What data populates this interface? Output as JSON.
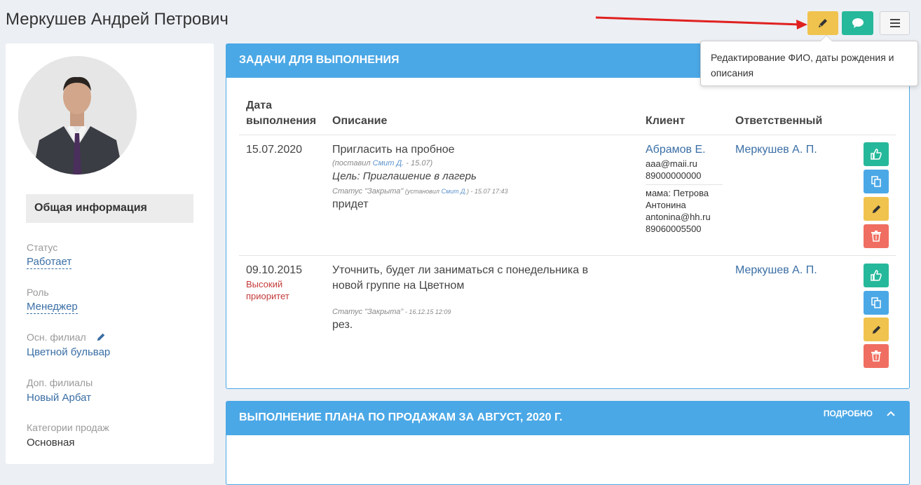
{
  "header": {
    "title": "Меркушев Андрей Петрович",
    "tooltip": "Редактирование ФИО, даты рождения и описания"
  },
  "sidebar": {
    "section_title": "Общая информация",
    "fields": [
      {
        "label": "Статус",
        "value": "Работает"
      },
      {
        "label": "Роль",
        "value": "Менеджер"
      },
      {
        "label": "Осн. филиал",
        "value": "Цветной бульвар"
      },
      {
        "label": "Доп. филиалы",
        "value": "Новый Арбат"
      },
      {
        "label": "Категории продаж",
        "value": "Основная"
      }
    ]
  },
  "tasks": {
    "title": "ЗАДАЧИ ДЛЯ ВЫПОЛНЕНИЯ",
    "columns": {
      "date": "Дата выполнения",
      "description": "Описание",
      "client": "Клиент",
      "responsible": "Ответственный"
    },
    "rows": [
      {
        "date": "15.07.2020",
        "priority": "",
        "description": "Пригласить на пробное",
        "set_prefix": "(поставил ",
        "set_by": "Смит Д.",
        "set_suffix": " - 15.07)",
        "goal": "Цель: Приглашение в лагерь",
        "status": "Статус \"Закрыта\"",
        "status_prefix": " (установил ",
        "status_by": "Смит Д.",
        "status_suffix": ") - 15.07 17:43",
        "result": "придет",
        "client_name": "Абрамов Е.",
        "client_email": "aaa@maii.ru",
        "client_phone": "89000000000",
        "client_parent_1": "мама: Петрова",
        "client_parent_2": "Антонина",
        "client_parent_email": "antonina@hh.ru",
        "client_parent_phone": "89060005500",
        "responsible": "Меркушев А. П."
      },
      {
        "date": "09.10.2015",
        "priority_1": "Высокий",
        "priority_2": "приоритет",
        "description_1": "Уточнить, будет ли заниматься с понедельника в",
        "description_2": "новой группе на Цветном",
        "status": "Статус \"Закрыта\"",
        "status_time": " - 16.12.15 12:09",
        "result": "рез.",
        "responsible": "Меркушев А. П."
      }
    ]
  },
  "sales": {
    "title": "ВЫПОЛНЕНИЕ ПЛАНА ПО ПРОДАЖАМ ЗА АВГУСТ, 2020 Г.",
    "details": "ПОДРОБНО"
  },
  "icons": {
    "edit": "pencil-icon",
    "chat": "chat-bubble-icon",
    "menu": "hamburger-icon",
    "like": "thumbs-up-icon",
    "copy": "copy-icon",
    "delete": "trash-icon"
  },
  "colors": {
    "panel_header": "#4ba8e6",
    "edit_button": "#f0c34e",
    "chat_button": "#26b89a",
    "delete_button": "#f06e61",
    "link": "#3a6ea5",
    "arrow": "#e02020"
  }
}
